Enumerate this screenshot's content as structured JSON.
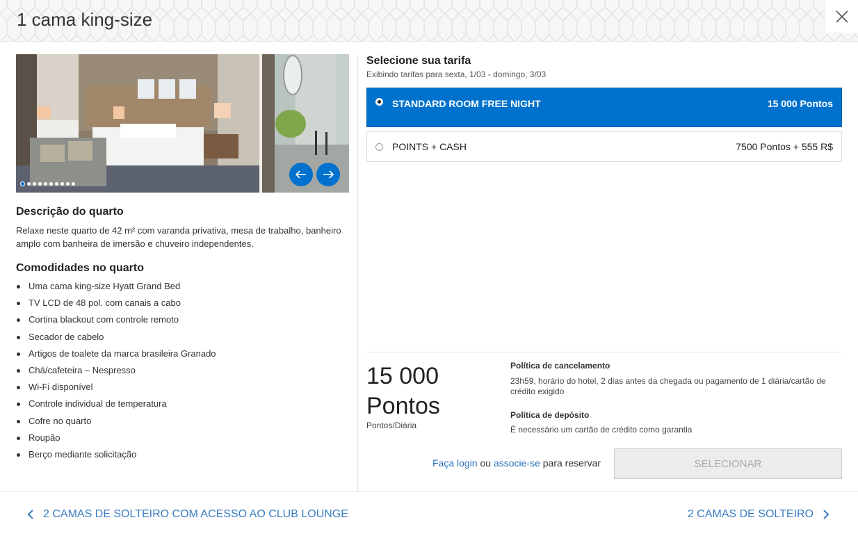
{
  "header": {
    "title": "1 cama king-size",
    "close_icon": "close-icon"
  },
  "gallery": {
    "slide_count": 10,
    "active_slide": 1,
    "prev_icon": "arrow-left-icon",
    "next_icon": "arrow-right-icon"
  },
  "description": {
    "title": "Descrição do quarto",
    "text": "Relaxe neste quarto de 42 m² com varanda privativa, mesa de trabalho, banheiro amplo com banheira de imersão e chuveiro independentes."
  },
  "amenities": {
    "title": "Comodidades no quarto",
    "items": [
      "Uma cama king-size Hyatt Grand Bed",
      "TV LCD de 48 pol. com canais a cabo",
      "Cortina blackout com controle remoto",
      "Secador de cabelo",
      "Artigos de toalete da marca brasileira Granado",
      "Chá/cafeteira – Nespresso",
      "Wi-Fi disponível",
      "Controle individual de temperatura",
      "Cofre no quarto",
      "Roupão",
      "Berço mediante solicitação"
    ]
  },
  "rates": {
    "title": "Selecione sua tarifa",
    "subtitle": "Exibindo tarifas para sexta, 1/03 - domingo, 3/03",
    "options": [
      {
        "label": "STANDARD ROOM FREE NIGHT",
        "price": "15 000 Pontos",
        "selected": true
      },
      {
        "label": "POINTS + CASH",
        "price": "7500 Pontos + 555 R$",
        "selected": false
      }
    ]
  },
  "summary": {
    "price_line1": "15 000",
    "price_line2": "Pontos",
    "per_night": "Pontos/Diária",
    "cancel_title": "Política de cancelamento",
    "cancel_text": "23h59, horário do hotel, 2 dias antes da chegada ou pagamento de 1 diária/cartão de crédito exigido",
    "deposit_title": "Política de depósito",
    "deposit_text": "É necessário um cartão de crédito como garantia"
  },
  "booking": {
    "login_link": "Faça login",
    "or_text": "ou",
    "join_link": "associe-se",
    "suffix": "para reservar",
    "select_button": "SELECIONAR"
  },
  "nav": {
    "prev_label": "2 CAMAS DE SOLTEIRO COM ACESSO AO CLUB LOUNGE",
    "next_label": "2 CAMAS DE SOLTEIRO"
  },
  "colors": {
    "accent": "#0072ce",
    "link": "#2a72b8"
  }
}
